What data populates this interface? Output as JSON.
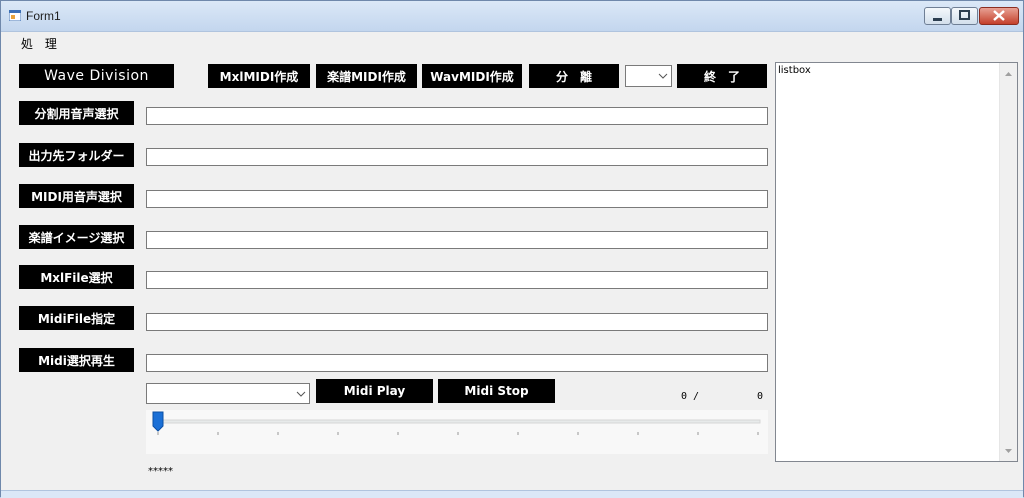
{
  "window": {
    "title": "Form1"
  },
  "menu": {
    "items": [
      "処 理"
    ]
  },
  "toolbar": {
    "wave_division": "Wave Division",
    "mxl_midi": "MxlMIDI作成",
    "score_midi": "楽譜MIDI作成",
    "wav_midi": "WavMIDI作成",
    "separate": "分　離",
    "separate_combo_value": "",
    "exit": "終　了"
  },
  "rows": [
    {
      "label": "分割用音声選択",
      "value": ""
    },
    {
      "label": "出力先フォルダー",
      "value": ""
    },
    {
      "label": "MIDI用音声選択",
      "value": ""
    },
    {
      "label": "楽譜イメージ選択",
      "value": ""
    },
    {
      "label": "MxlFile選択",
      "value": ""
    },
    {
      "label": "MidiFile指定",
      "value": ""
    },
    {
      "label": "Midi選択再生",
      "value": ""
    }
  ],
  "playback": {
    "combo_value": "",
    "play": "Midi Play",
    "stop": "Midi Stop",
    "position": "0 /",
    "total": "0",
    "slider_value": 0
  },
  "listbox": {
    "items": [
      "listbox"
    ]
  },
  "status": {
    "text": "*****"
  }
}
